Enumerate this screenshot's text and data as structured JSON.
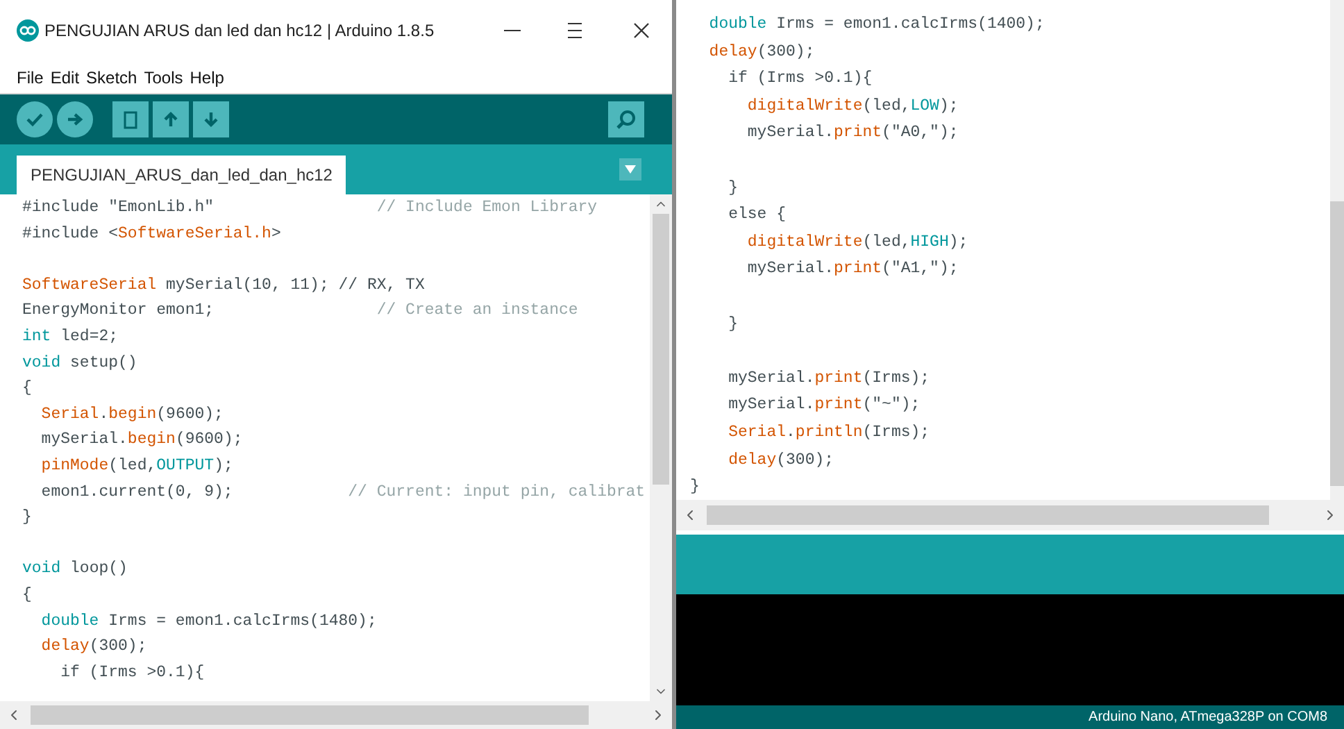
{
  "left_window": {
    "title": "PENGUJIAN ARUS dan led dan hc12 | Arduino 1.8.5",
    "menu": [
      "File",
      "Edit",
      "Sketch",
      "Tools",
      "Help"
    ],
    "tabs": [
      {
        "label": "PENGUJIAN_ARUS_dan_led_dan_hc12",
        "selected": true
      }
    ],
    "code": [
      {
        "parts": [
          {
            "text": "#include \"EmonLib.h\"                 ",
            "kind": "plain"
          },
          {
            "text": "// Include Emon Library",
            "kind": "comment"
          }
        ]
      },
      {
        "parts": [
          {
            "text": "#include <",
            "kind": "plain"
          },
          {
            "text": "SoftwareSerial.h",
            "kind": "func"
          },
          {
            "text": ">",
            "kind": "plain"
          }
        ]
      },
      {
        "gap_before": true,
        "parts": [
          {
            "text": "SoftwareSerial",
            "kind": "func"
          },
          {
            "text": " mySerial(10, 11); // RX, TX",
            "kind": "plain"
          }
        ]
      },
      {
        "parts": [
          {
            "text": "EnergyMonitor emon1;                 ",
            "kind": "plain"
          },
          {
            "text": "// Create an instance",
            "kind": "comment"
          }
        ]
      },
      {
        "parts": [
          {
            "text": "int",
            "kind": "type"
          },
          {
            "text": " led=2;",
            "kind": "plain"
          }
        ]
      },
      {
        "parts": [
          {
            "text": "void",
            "kind": "type"
          },
          {
            "text": " setup()",
            "kind": "plain"
          }
        ]
      },
      {
        "parts": [
          {
            "text": "{",
            "kind": "plain"
          }
        ]
      },
      {
        "parts": [
          {
            "text": "  Serial",
            "kind": "func"
          },
          {
            "text": ".",
            "kind": "plain"
          },
          {
            "text": "begin",
            "kind": "func"
          },
          {
            "text": "(9600);",
            "kind": "plain"
          }
        ]
      },
      {
        "parts": [
          {
            "text": "  mySerial.",
            "kind": "plain"
          },
          {
            "text": "begin",
            "kind": "func"
          },
          {
            "text": "(9600);",
            "kind": "plain"
          }
        ]
      },
      {
        "parts": [
          {
            "text": "  pinMode",
            "kind": "func"
          },
          {
            "text": "(led,",
            "kind": "plain"
          },
          {
            "text": "OUTPUT",
            "kind": "const"
          },
          {
            "text": ");",
            "kind": "plain"
          }
        ]
      },
      {
        "parts": [
          {
            "text": "  emon1.current(0, 9);            ",
            "kind": "plain"
          },
          {
            "text": "// Current: input pin, calibrat",
            "kind": "comment"
          }
        ]
      },
      {
        "parts": [
          {
            "text": "}",
            "kind": "plain"
          }
        ]
      },
      {
        "gap_before": true,
        "parts": [
          {
            "text": "void",
            "kind": "type"
          },
          {
            "text": " loop()",
            "kind": "plain"
          }
        ]
      },
      {
        "parts": [
          {
            "text": "{",
            "kind": "plain"
          }
        ]
      },
      {
        "parts": [
          {
            "text": "  double",
            "kind": "type"
          },
          {
            "text": " Irms = emon1.calcIrms(1480);",
            "kind": "plain"
          }
        ]
      },
      {
        "parts": [
          {
            "text": "  delay",
            "kind": "func"
          },
          {
            "text": "(300);",
            "kind": "plain"
          }
        ]
      },
      {
        "parts": [
          {
            "text": "    if (Irms >0.1){",
            "kind": "plain"
          }
        ]
      }
    ]
  },
  "right_window": {
    "code": [
      {
        "parts": [
          {
            "text": "  double",
            "kind": "type"
          },
          {
            "text": " Irms = emon1.calcIrms(1400);",
            "kind": "plain"
          }
        ]
      },
      {
        "parts": [
          {
            "text": "  delay",
            "kind": "func"
          },
          {
            "text": "(300);",
            "kind": "plain"
          }
        ]
      },
      {
        "parts": [
          {
            "text": "    if (Irms >0.1){",
            "kind": "plain"
          }
        ]
      },
      {
        "parts": [
          {
            "text": "      digitalWrite",
            "kind": "func"
          },
          {
            "text": "(led,",
            "kind": "plain"
          },
          {
            "text": "LOW",
            "kind": "const"
          },
          {
            "text": ");",
            "kind": "plain"
          }
        ]
      },
      {
        "parts": [
          {
            "text": "      mySerial.",
            "kind": "plain"
          },
          {
            "text": "print",
            "kind": "func"
          },
          {
            "text": "(\"A0,\");",
            "kind": "plain"
          }
        ]
      },
      {
        "gap_before": true,
        "parts": [
          {
            "text": "    }",
            "kind": "plain"
          }
        ]
      },
      {
        "parts": [
          {
            "text": "    else {",
            "kind": "plain"
          }
        ]
      },
      {
        "parts": [
          {
            "text": "      digitalWrite",
            "kind": "func"
          },
          {
            "text": "(led,",
            "kind": "plain"
          },
          {
            "text": "HIGH",
            "kind": "const"
          },
          {
            "text": ");",
            "kind": "plain"
          }
        ]
      },
      {
        "parts": [
          {
            "text": "      mySerial.",
            "kind": "plain"
          },
          {
            "text": "print",
            "kind": "func"
          },
          {
            "text": "(\"A1,\");",
            "kind": "plain"
          }
        ]
      },
      {
        "gap_before": true,
        "parts": [
          {
            "text": "    }",
            "kind": "plain"
          }
        ]
      },
      {
        "gap_before": true,
        "parts": [
          {
            "text": "    mySerial.",
            "kind": "plain"
          },
          {
            "text": "print",
            "kind": "func"
          },
          {
            "text": "(Irms);",
            "kind": "plain"
          }
        ]
      },
      {
        "parts": [
          {
            "text": "    mySerial.",
            "kind": "plain"
          },
          {
            "text": "print",
            "kind": "func"
          },
          {
            "text": "(\"~\");",
            "kind": "plain"
          }
        ]
      },
      {
        "parts": [
          {
            "text": "    Serial",
            "kind": "func"
          },
          {
            "text": ".",
            "kind": "plain"
          },
          {
            "text": "println",
            "kind": "func"
          },
          {
            "text": "(Irms);",
            "kind": "plain"
          }
        ]
      },
      {
        "parts": [
          {
            "text": "    delay",
            "kind": "func"
          },
          {
            "text": "(300);",
            "kind": "plain"
          }
        ]
      },
      {
        "parts": [
          {
            "text": "}",
            "kind": "plain"
          }
        ]
      }
    ],
    "status_bar": "Arduino Nano, ATmega328P on COM8"
  }
}
